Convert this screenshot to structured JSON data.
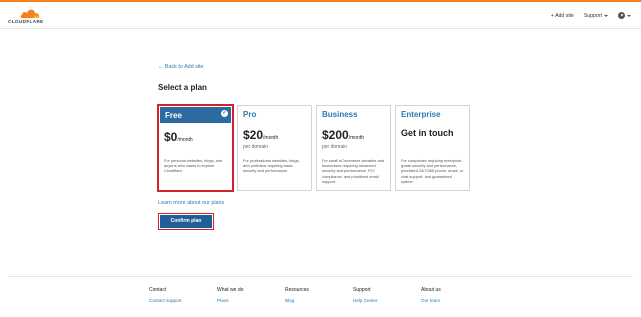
{
  "header": {
    "logo_text": "CLOUDFLARE",
    "add_site": "+ Add site",
    "support": "Support",
    "user_icon": "user-icon"
  },
  "main": {
    "back_link": "← Back to Add site",
    "title": "Select a plan",
    "plans": [
      {
        "name": "Free",
        "price": "$0",
        "unit": "/month",
        "per": "",
        "description": "For personal websites, blogs, and anyone who wants to explore Cloudflare.",
        "selected": true
      },
      {
        "name": "Pro",
        "price": "$20",
        "unit": "/month",
        "per": "per domain",
        "description": "For professional websites, blogs, and portfolios requiring basic security and performance.",
        "selected": false
      },
      {
        "name": "Business",
        "price": "$200",
        "unit": "/month",
        "per": "per domain",
        "description": "For small eCommerce websites and businesses requiring advanced security and performance, PCI compliance, and prioritized email support.",
        "selected": false
      },
      {
        "name": "Enterprise",
        "cta": "Get in touch",
        "description": "For companies requiring enterprise-grade security and performance, prioritized 24/7/365 phone, email, or chat support, and guaranteed uptime.",
        "selected": false
      }
    ],
    "learn_more": "Learn more about our plans",
    "confirm": "Confirm plan"
  },
  "footer": {
    "columns": [
      {
        "heading": "Contact",
        "link": "Contact support"
      },
      {
        "heading": "What we do",
        "link": "Plans"
      },
      {
        "heading": "Resources",
        "link": "Blog"
      },
      {
        "heading": "Support",
        "link": "Help Center"
      },
      {
        "heading": "About us",
        "link": "Our team"
      }
    ]
  },
  "colors": {
    "accent_orange": "#f6821f",
    "link_blue": "#2c7cb0",
    "selected_red": "#d1222a",
    "button_blue": "#1f5e96"
  }
}
